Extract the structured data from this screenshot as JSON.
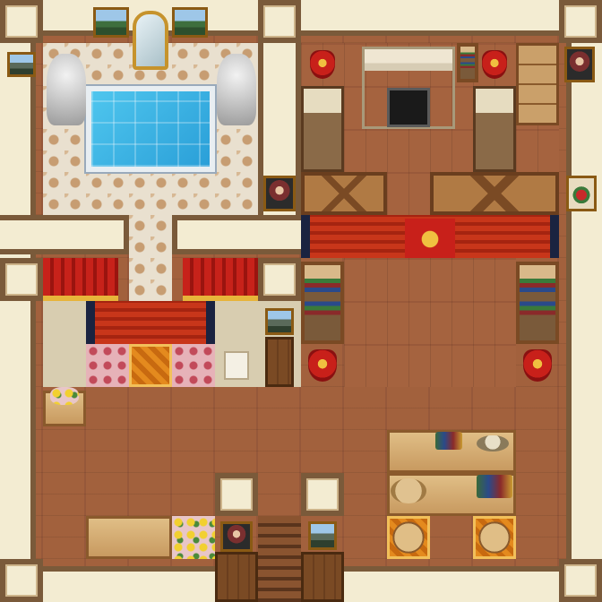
{
  "scene": {
    "rooms": [
      "bath-hall",
      "bedroom",
      "throne-room",
      "entry-hall",
      "study"
    ],
    "palette": {
      "wall": "#f3ecd2",
      "trim": "#7a5a3a",
      "wood": "#a2613d",
      "carpet": "#c8361a",
      "pool": "#2a9fd8",
      "gold": "#e7b43a"
    },
    "icons": [
      "statue-icon",
      "mirror-icon",
      "painting-icon",
      "portrait-icon",
      "crest-icon",
      "throne-icon",
      "bookshelf-icon",
      "fireplace-icon",
      "bed-icon",
      "dresser-icon",
      "crate-icon",
      "door-icon",
      "stairs-icon",
      "flower-pot-icon",
      "notice-icon",
      "potion-icon",
      "sack-icon",
      "wine-bottle-icon"
    ]
  }
}
